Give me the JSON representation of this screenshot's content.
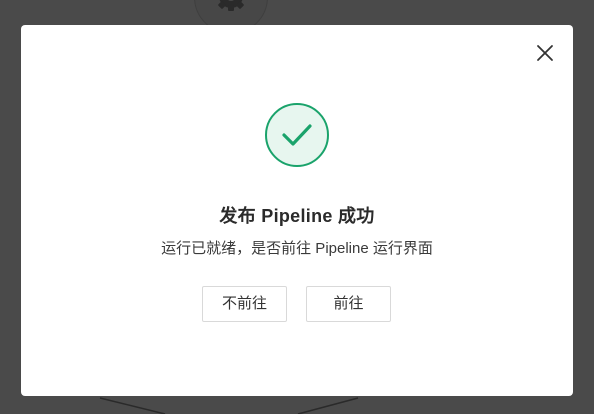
{
  "dialog": {
    "title": "发布 Pipeline 成功",
    "message": "运行已就绪，是否前往 Pipeline 运行界面",
    "cancel_label": "不前往",
    "confirm_label": "前往",
    "close_icon": "close-icon",
    "status_icon": "success-check-icon"
  },
  "background": {
    "node_icon": "gear-icon"
  },
  "colors": {
    "success": "#1aa36b",
    "success_fill": "#e7f6ef",
    "overlay": "#4a4a4a"
  }
}
